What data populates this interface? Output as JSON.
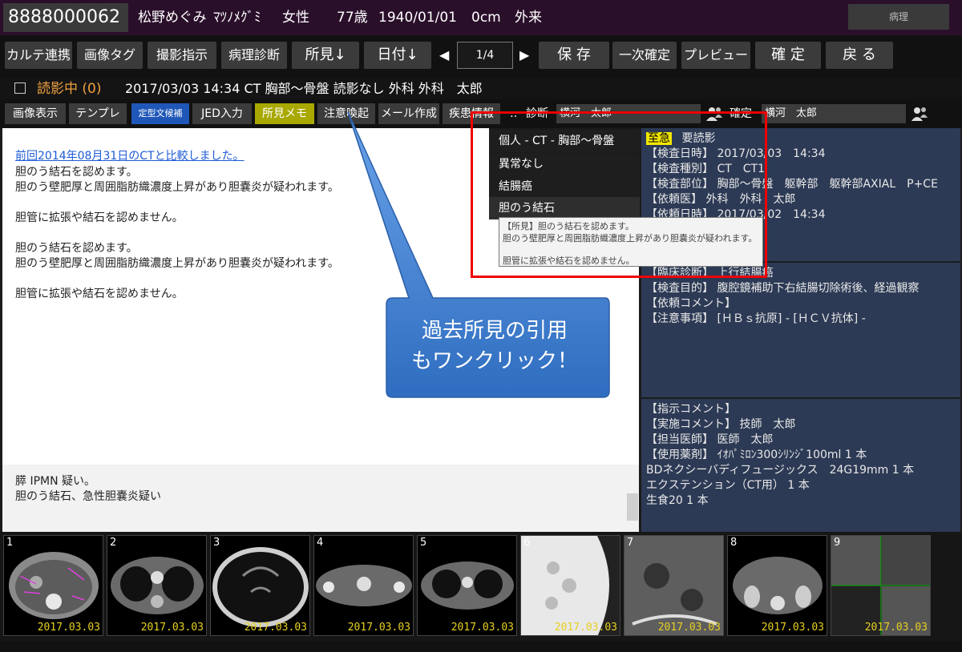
{
  "header": {
    "patient_id": "8888000062",
    "patient_name": "松野めぐみ",
    "patient_kana": "ﾏﾂﾉﾒｸﾞﾐ",
    "sex": "女性",
    "age": "77歳",
    "birthdate": "1940/01/01",
    "height": "0cm",
    "visit_type": "外来",
    "pathology_label": "病理"
  },
  "toolbar": {
    "karte_link": "カルテ連携",
    "image_tag": "画像タグ",
    "shooting_instruction": "撮影指示",
    "pathology_diagnosis": "病理診断",
    "findings_sort": "所見↓",
    "date_sort": "日付↓",
    "page": "1/4",
    "save": "保 存",
    "primary_confirm": "一次確定",
    "preview": "プレビュー",
    "confirm": "確 定",
    "back": "戻 る"
  },
  "status": {
    "reading": "読影中 (0)",
    "exam_summary": "2017/03/03 14:34 CT 胸部～骨盤 読影なし 外科 外科　太郎"
  },
  "subtoolbar": {
    "image_display": "画像表示",
    "template": "テンプレ",
    "fixed_text": "定型文候補",
    "jed_input": "JED入力",
    "findings_memo": "所見メモ",
    "caution": "注意喚起",
    "mail": "メール作成",
    "disease_info": "疾患情報",
    "more": "‥",
    "diagnosis_label": "診断",
    "diagnosis_doctor": "横河　太郎",
    "confirm_label": "確定",
    "confirm_doctor": "横河　太郎"
  },
  "report": {
    "link": "前回2014年08月31日のCTと比較しました。",
    "lines": [
      "胆のう結石を認めます。",
      "胆のう壁肥厚と周囲脂肪織濃度上昇があり胆嚢炎が疑われます。",
      "胆管に拡張や結石を認めません。",
      "胆のう結石を認めます。",
      "胆のう壁肥厚と周囲脂肪織濃度上昇があり胆嚢炎が疑われます。",
      "胆管に拡張や結石を認めません。"
    ],
    "impression": [
      "膵 IPMN 疑い。",
      "胆のう結石、急性胆嚢炎疑い"
    ]
  },
  "popup": {
    "items": [
      "個人 - CT - 胸部～骨盤",
      "異常なし",
      "結腸癌",
      "胆のう結石"
    ],
    "tooltip": [
      "【所見】胆のう結石を認めます。",
      "胆のう壁肥厚と周囲脂肪織濃度上昇があり胆嚢炎が疑われます。",
      "胆管に拡張や結石を認めません。"
    ]
  },
  "callout": {
    "line1": "過去所見の引用",
    "line2": "もワンクリック！"
  },
  "info": {
    "urgent": "至急",
    "needs_reading": "要読影",
    "panel1": [
      "【検査日時】 2017/03/03　14:34",
      "【検査種別】 CT　CT1",
      "【検査部位】 胸部～骨盤　躯幹部　躯幹部AXIAL　P+CE",
      "【依頼医】 外科　外科　太郎",
      "【依頼日時】 2017/03/02　14:34"
    ],
    "panel2": [
      "【臨床診断】 上行結腸癌",
      "【検査目的】 腹腔鏡補助下右結腸切除術後、経過観察",
      "【依頼コメント】",
      "【注意事項】 [ＨＢｓ抗原] - [ＨＣＶ抗体] -"
    ],
    "panel3": [
      "【指示コメント】",
      "【実施コメント】 技師　太郎",
      "【担当医師】 医師　太郎",
      "【使用薬剤】 ｲｵﾊﾟﾐﾛﾝ300ｼﾘﾝｼﾞ100ml 1 本",
      "BDネクシーバディフュージックス　24G19mm 1 本",
      "エクステンション（CT用） 1 本",
      "生食20 1 本"
    ]
  },
  "thumbnails": [
    {
      "num": "1",
      "date": "2017.03.03"
    },
    {
      "num": "2",
      "date": "2017.03.03"
    },
    {
      "num": "3",
      "date": "2017.03.03"
    },
    {
      "num": "4",
      "date": "2017.03.03"
    },
    {
      "num": "5",
      "date": "2017.03.03"
    },
    {
      "num": "6",
      "date": "2017.03.03"
    },
    {
      "num": "7",
      "date": "2017.03.03"
    },
    {
      "num": "8",
      "date": "2017.03.03"
    },
    {
      "num": "9",
      "date": "2017.03.03"
    }
  ],
  "colors": {
    "header_bg": "#2a0f2a",
    "accent_orange": "#f0a040",
    "highlight_red": "#ee0000",
    "callout_blue": "#3f7ed0",
    "urgent_yellow": "#f2e600",
    "thumb_date": "#e8d020"
  }
}
